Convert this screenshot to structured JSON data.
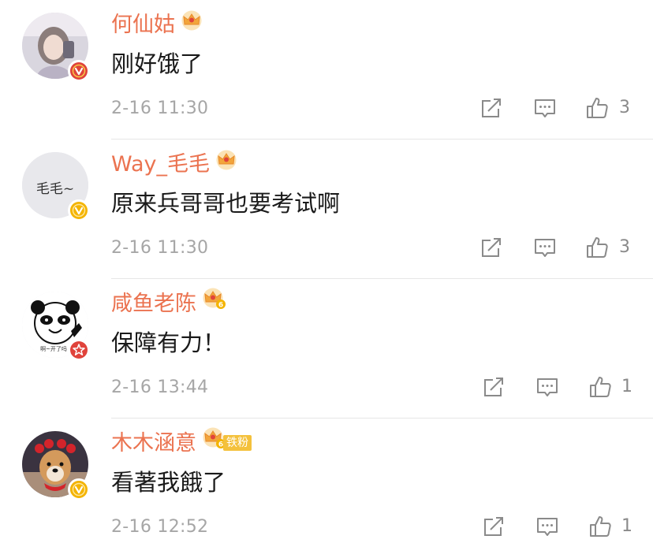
{
  "comments": [
    {
      "username": "何仙姑",
      "text": "刚好饿了",
      "time": "2-16 11:30",
      "likes": "3",
      "badge": "red-v",
      "crown_level": ""
    },
    {
      "username": "Way_毛毛",
      "text": "原来兵哥哥也要考试啊",
      "time": "2-16 11:30",
      "likes": "3",
      "badge": "yellow-v",
      "crown_level": "",
      "avatar_text": "毛毛~"
    },
    {
      "username": "咸鱼老陈",
      "text": "保障有力！",
      "time": "2-16 13:44",
      "likes": "1",
      "badge": "red-star",
      "crown_level": "6",
      "avatar_caption": "啊~开了吗"
    },
    {
      "username": "木木涵意",
      "text": "看著我餓了",
      "time": "2-16 12:52",
      "likes": "1",
      "badge": "yellow-v",
      "crown_level": "6",
      "fan_tag": "铁粉"
    }
  ],
  "icons": {
    "share": "share-icon",
    "comment": "comment-icon",
    "like": "thumbs-up-icon",
    "crown": "crown-icon"
  },
  "colors": {
    "username": "#eb7350",
    "text": "#1a1a1a",
    "meta": "#a6a6a6",
    "badge_red": "#e0433b",
    "badge_yellow": "#f4b400"
  }
}
